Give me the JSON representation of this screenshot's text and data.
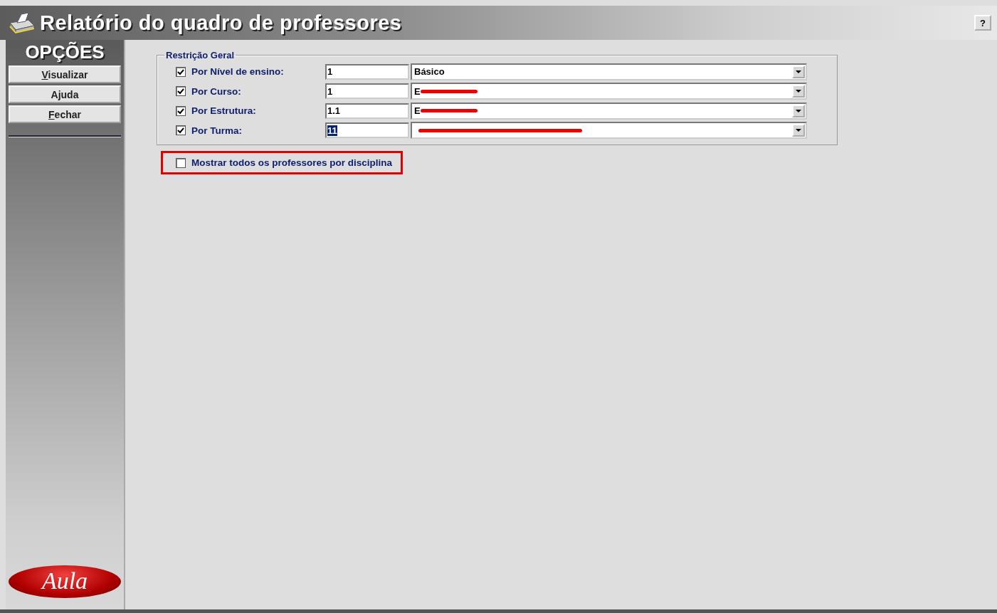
{
  "window": {
    "title": "Relatório do quadro de professores",
    "help_button": "?"
  },
  "sidebar": {
    "heading": "OPÇÕES",
    "buttons": [
      {
        "label": "Visualizar",
        "underline_first": true
      },
      {
        "label": "Ajuda",
        "underline_first": false
      },
      {
        "label": "Fechar",
        "underline_first": true
      }
    ],
    "logo": "Aula"
  },
  "group": {
    "title": "Restrição Geral",
    "rows": [
      {
        "label": "Por Nível de ensino:",
        "checked": true,
        "code": "1",
        "code_selected": false,
        "value": "Básico",
        "redacted": false
      },
      {
        "label": "Por Curso:",
        "checked": true,
        "code": "1",
        "code_selected": false,
        "value": "E",
        "redacted": true
      },
      {
        "label": "Por Estrutura:",
        "checked": true,
        "code": "1.1",
        "code_selected": false,
        "value": "E",
        "redacted": true
      },
      {
        "label": "Por Turma:",
        "checked": true,
        "code": "11",
        "code_selected": true,
        "value": "",
        "redacted": true
      }
    ]
  },
  "option": {
    "label": "Mostrar todos os professores por disciplina",
    "checked": false,
    "highlighted": true
  }
}
